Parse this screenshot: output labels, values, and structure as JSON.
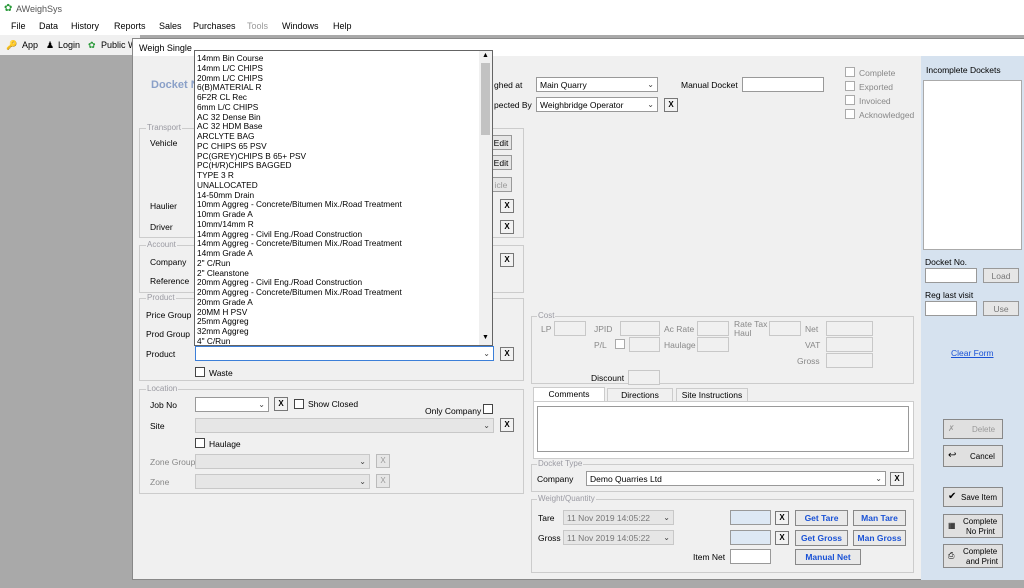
{
  "app": {
    "title": "AWeighSys"
  },
  "menu": [
    "File",
    "Data",
    "History",
    "Reports",
    "Sales",
    "Purchases",
    "Tools",
    "Windows",
    "Help"
  ],
  "toolbar": {
    "app": "App",
    "login": "Login",
    "public": "Public W"
  },
  "window": {
    "title": "Weigh Single",
    "docket_heading": "Docket N"
  },
  "header": {
    "weighed_at_label": "ghed at",
    "weighed_at_value": "Main Quarry",
    "inspected_by_label": "pected By",
    "inspected_by_value": "Weighbridge Operator",
    "manual_docket_label": "Manual Docket",
    "manual_docket_value": "",
    "x": "X"
  },
  "status": {
    "complete": "Complete",
    "exported": "Exported",
    "invoiced": "Invoiced",
    "acknowledged": "Acknowledged"
  },
  "transport": {
    "legend": "Transport",
    "vehicle": "Vehicle",
    "haulier": "Haulier",
    "driver": "Driver",
    "edit1": "Edit",
    "edit2": "Edit",
    "vehicle_btn": "icle"
  },
  "account": {
    "legend": "Account",
    "company": "Company",
    "reference": "Reference"
  },
  "product": {
    "legend": "Product",
    "price_group": "Price Group",
    "prod_group": "Prod Group",
    "product": "Product",
    "waste": "Waste",
    "value": ""
  },
  "location": {
    "legend": "Location",
    "job_no": "Job No",
    "show_closed": "Show Closed",
    "only_company": "Only Company",
    "site": "Site",
    "haulage": "Haulage",
    "zone_group": "Zone Group",
    "zone": "Zone"
  },
  "cost": {
    "legend": "Cost",
    "lp": "LP",
    "jpid": "JPID",
    "pl": "P/L",
    "ac_rate": "Ac Rate",
    "haulage": "Haulage",
    "rate_tax_haul": "Rate Tax Haul",
    "net": "Net",
    "vat": "VAT",
    "gross": "Gross",
    "discount": "Discount"
  },
  "tabs": [
    "Comments",
    "Directions",
    "Site Instructions"
  ],
  "docket_type": {
    "legend": "Docket Type",
    "company_label": "Company",
    "company_value": "Demo Quarries Ltd"
  },
  "weight": {
    "legend": "Weight/Quantity",
    "tare": "Tare",
    "tare_date": "11 Nov 2019 14:05:22",
    "gross": "Gross",
    "gross_date": "11 Nov 2019 14:05:22",
    "item_net": "Item Net",
    "get_tare": "Get Tare",
    "man_tare": "Man Tare",
    "get_gross": "Get Gross",
    "man_gross": "Man Gross",
    "manual_net": "Manual Net"
  },
  "sidebar": {
    "incomplete_dockets": "Incomplete Dockets",
    "docket_no": "Docket No.",
    "load": "Load",
    "reg_last_visit": "Reg last visit",
    "use": "Use",
    "clear_form": "Clear Form",
    "delete": "Delete",
    "cancel": "Cancel",
    "save_item": "Save Item",
    "complete_no_print_1": "Complete",
    "complete_no_print_2": "No Print",
    "complete_and_print_1": "Complete",
    "complete_and_print_2": "and Print"
  },
  "dropdown_items": [
    "14mm Bin Course",
    "14mm L/C CHIPS",
    "20mm L/C CHIPS",
    "6(B)MATERIAL R",
    "6F2R CL Rec",
    "6mm L/C CHIPS",
    "AC 32 Dense Bin",
    "AC 32 HDM Base",
    "ARCLYTE BAG",
    "PC CHIPS 65 PSV",
    "PC(GREY)CHIPS B 65+ PSV",
    "PC(H/R)CHIPS BAGGED",
    "TYPE 3 R",
    "UNALLOCATED",
    "14-50mm Drain",
    "10mm Aggreg - Concrete/Bitumen Mix./Road Treatment",
    "10mm Grade A",
    "10mm/14mm R",
    "14mm Aggreg - Civil  Eng./Road Construction",
    "14mm Aggreg - Concrete/Bitumen Mix./Road Treatment",
    "14mm Grade A",
    "2\" C/Run",
    "2\" Cleanstone",
    "20mm Aggreg - Civil  Eng./Road Construction",
    "20mm Aggreg - Concrete/Bitumen Mix./Road Treatment",
    "20mm Grade A",
    "20MM H PSV",
    "25mm Aggreg",
    "32mm Aggreg",
    "4\" C/Run"
  ]
}
